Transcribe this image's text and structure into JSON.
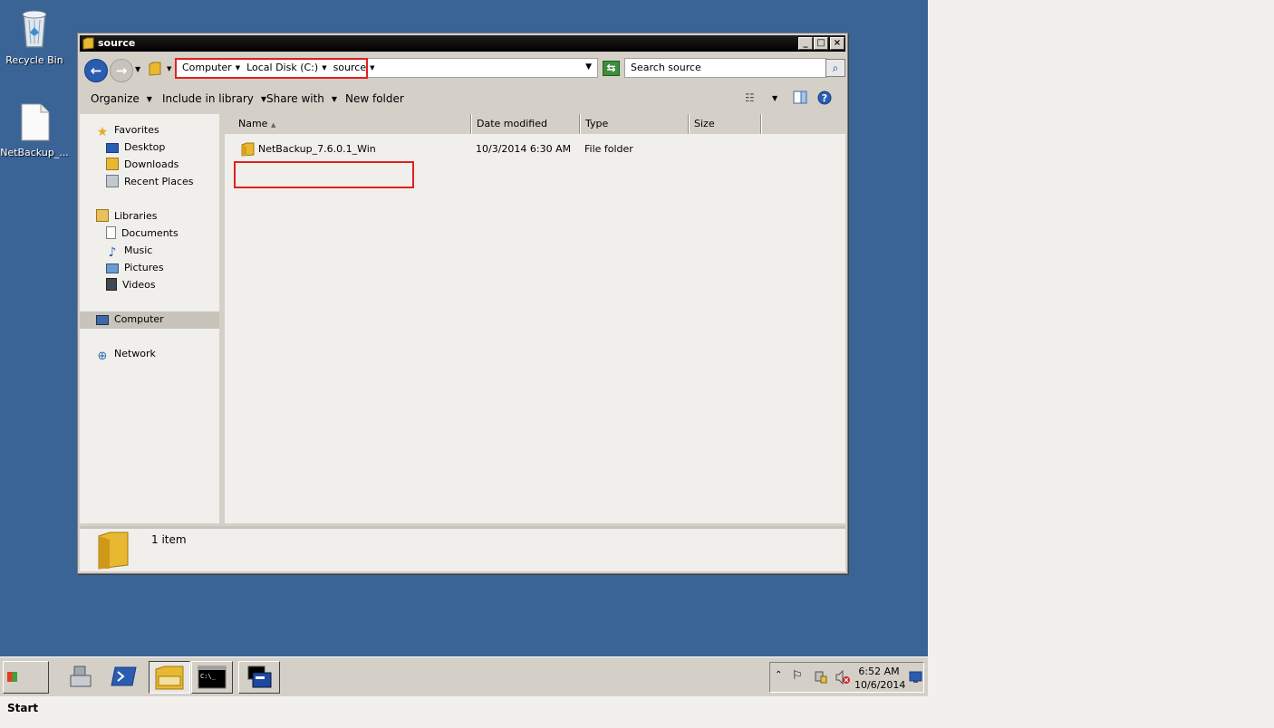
{
  "desktop": {
    "icons": [
      {
        "label": "Recycle Bin"
      },
      {
        "label": "NetBackup_..."
      }
    ]
  },
  "window": {
    "title": "source",
    "breadcrumbs": [
      "Computer",
      "Local Disk (C:)",
      "source"
    ],
    "search_placeholder": "Search source",
    "toolbar": {
      "organize": "Organize",
      "include_in_library": "Include in library",
      "share_with": "Share with",
      "new_folder": "New folder"
    },
    "nav": {
      "favorites": "Favorites",
      "desktop": "Desktop",
      "downloads": "Downloads",
      "recent_places": "Recent Places",
      "libraries": "Libraries",
      "documents": "Documents",
      "music": "Music",
      "pictures": "Pictures",
      "videos": "Videos",
      "computer": "Computer",
      "network": "Network"
    },
    "columns": {
      "name": "Name",
      "date_modified": "Date modified",
      "type": "Type",
      "size": "Size"
    },
    "files": [
      {
        "name": "NetBackup_7.6.0.1_Win",
        "date_modified": "10/3/2014 6:30 AM",
        "type": "File folder",
        "size": ""
      }
    ],
    "status": {
      "count": "1 item"
    }
  },
  "taskbar": {
    "start_label": "Start",
    "clock_time": "6:52 AM",
    "clock_date": "10/6/2014"
  },
  "colors": {
    "desktop": "#3a6396",
    "highlight": "#e02020",
    "folder": "#e8b830"
  }
}
